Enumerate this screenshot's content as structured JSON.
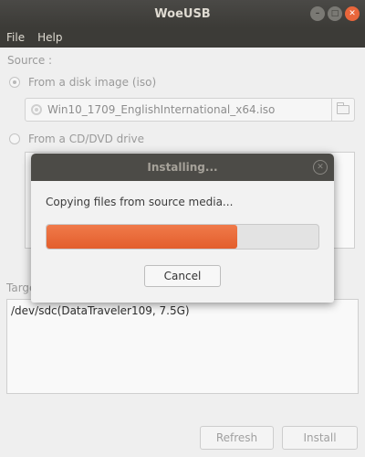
{
  "window": {
    "title": "WoeUSB"
  },
  "menu": {
    "items": [
      "File",
      "Help"
    ]
  },
  "source": {
    "label": "Source :",
    "from_image_label": "From a disk image (iso)",
    "image_path": "Win10_1709_EnglishInternational_x64.iso",
    "from_drive_label": "From a CD/DVD drive"
  },
  "target": {
    "label": "Target device :",
    "devices": [
      "/dev/sdc(DataTraveler109,  7.5G)"
    ]
  },
  "buttons": {
    "refresh": "Refresh",
    "install": "Install"
  },
  "dialog": {
    "title": "Installing...",
    "message": "Copying files from source media...",
    "progress_percent": 70,
    "cancel": "Cancel"
  },
  "colors": {
    "accent": "#e9663b",
    "titlebar": "#3c3b37"
  }
}
